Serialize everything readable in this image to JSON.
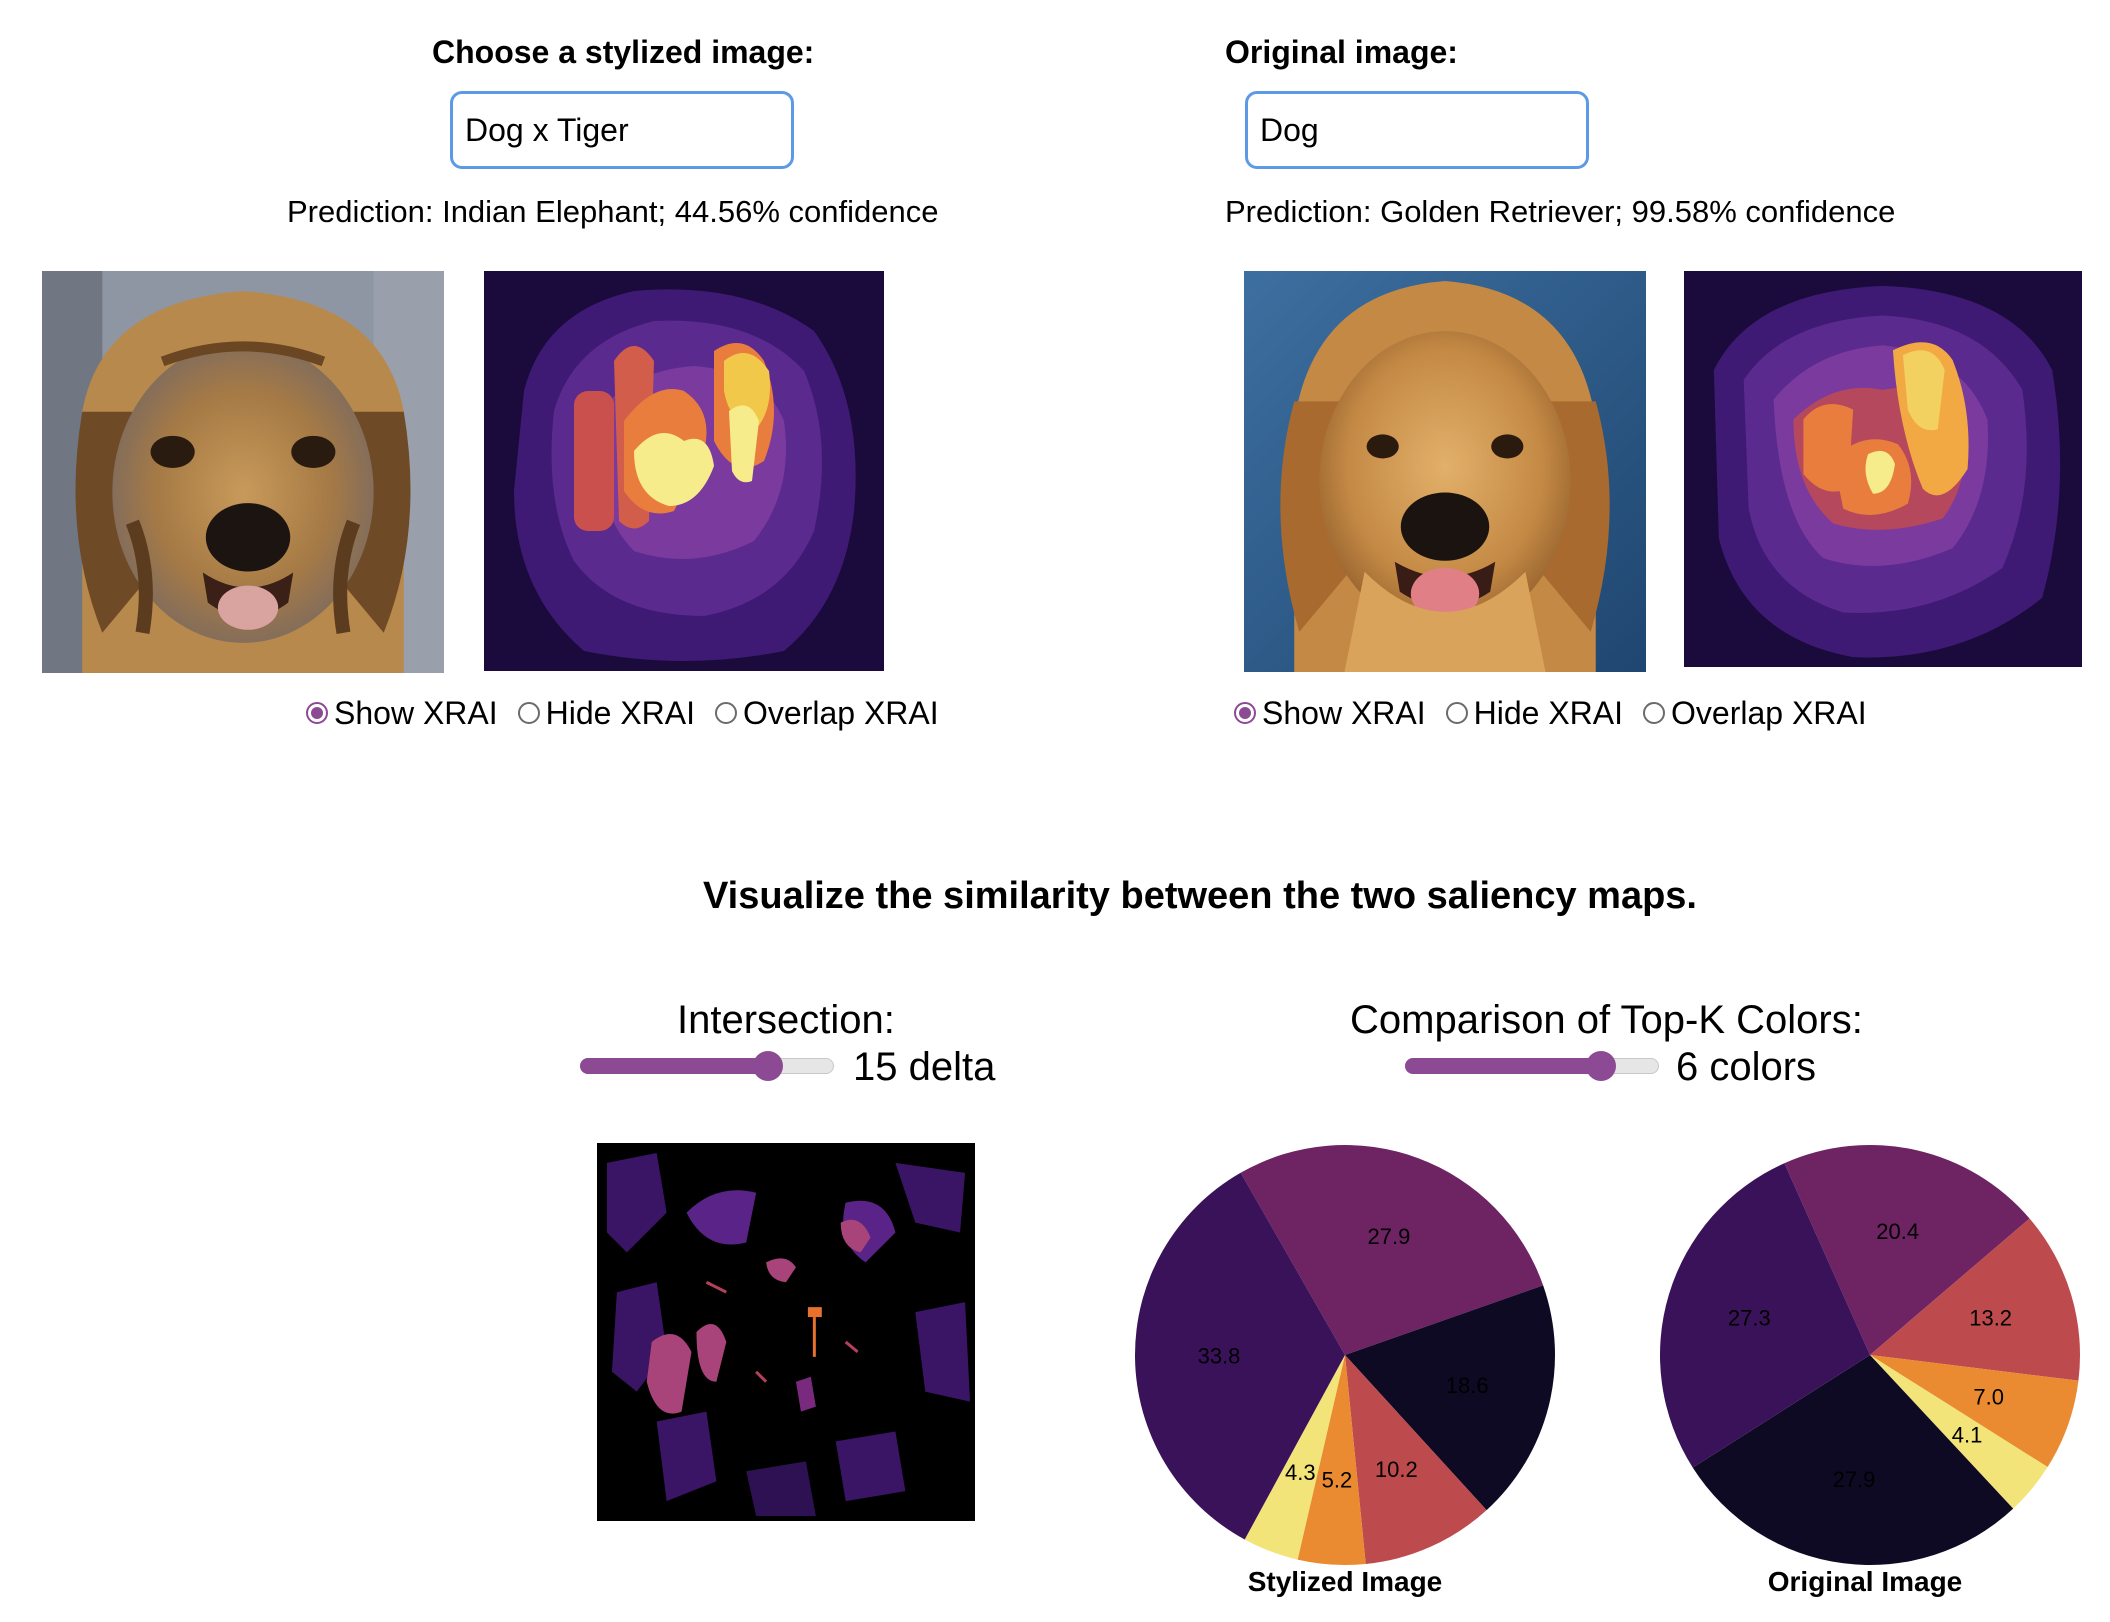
{
  "left_panel": {
    "heading": "Choose a stylized image:",
    "select_value": "Dog x Tiger",
    "prediction": "Prediction: Indian Elephant; 44.56% confidence",
    "radios": [
      {
        "label": "Show XRAI",
        "checked": true
      },
      {
        "label": "Hide XRAI",
        "checked": false
      },
      {
        "label": "Overlap XRAI",
        "checked": false
      }
    ]
  },
  "right_panel": {
    "heading": "Original image:",
    "select_value": "Dog",
    "prediction": "Prediction: Golden Retriever; 99.58% confidence",
    "radios": [
      {
        "label": "Show XRAI",
        "checked": true
      },
      {
        "label": "Hide XRAI",
        "checked": false
      },
      {
        "label": "Overlap XRAI",
        "checked": false
      }
    ]
  },
  "similarity": {
    "title": "Visualize the similarity between the two saliency maps.",
    "intersection": {
      "label": "Intersection:",
      "value_text": "15 delta",
      "slider_fraction": 0.74
    },
    "topk": {
      "label": "Comparison of Top-K Colors:",
      "value_text": "6 colors",
      "slider_fraction": 0.77
    }
  },
  "colors": {
    "accent": "#8b4a93",
    "select_border": "#5d9ae6"
  },
  "chart_data": [
    {
      "type": "pie",
      "title": "Stylized Image",
      "values": [
        27.9,
        18.6,
        10.2,
        5.2,
        4.3,
        33.8
      ],
      "labels": [
        "27.9",
        "18.6",
        "10.2",
        "5.2",
        "4.3",
        "33.8"
      ],
      "colors": [
        "#6e2363",
        "#0f0a24",
        "#bd4a4d",
        "#ea8b32",
        "#f3e479",
        "#3a1259"
      ]
    },
    {
      "type": "pie",
      "title": "Original Image",
      "values": [
        20.4,
        13.2,
        7.0,
        4.1,
        27.9,
        27.3
      ],
      "labels": [
        "20.4",
        "13.2",
        "7.0",
        "4.1",
        "27.9",
        "27.3"
      ],
      "colors": [
        "#6e2363",
        "#bd4a4d",
        "#ea8b32",
        "#f3e479",
        "#0f0a24",
        "#3a1259"
      ]
    }
  ]
}
